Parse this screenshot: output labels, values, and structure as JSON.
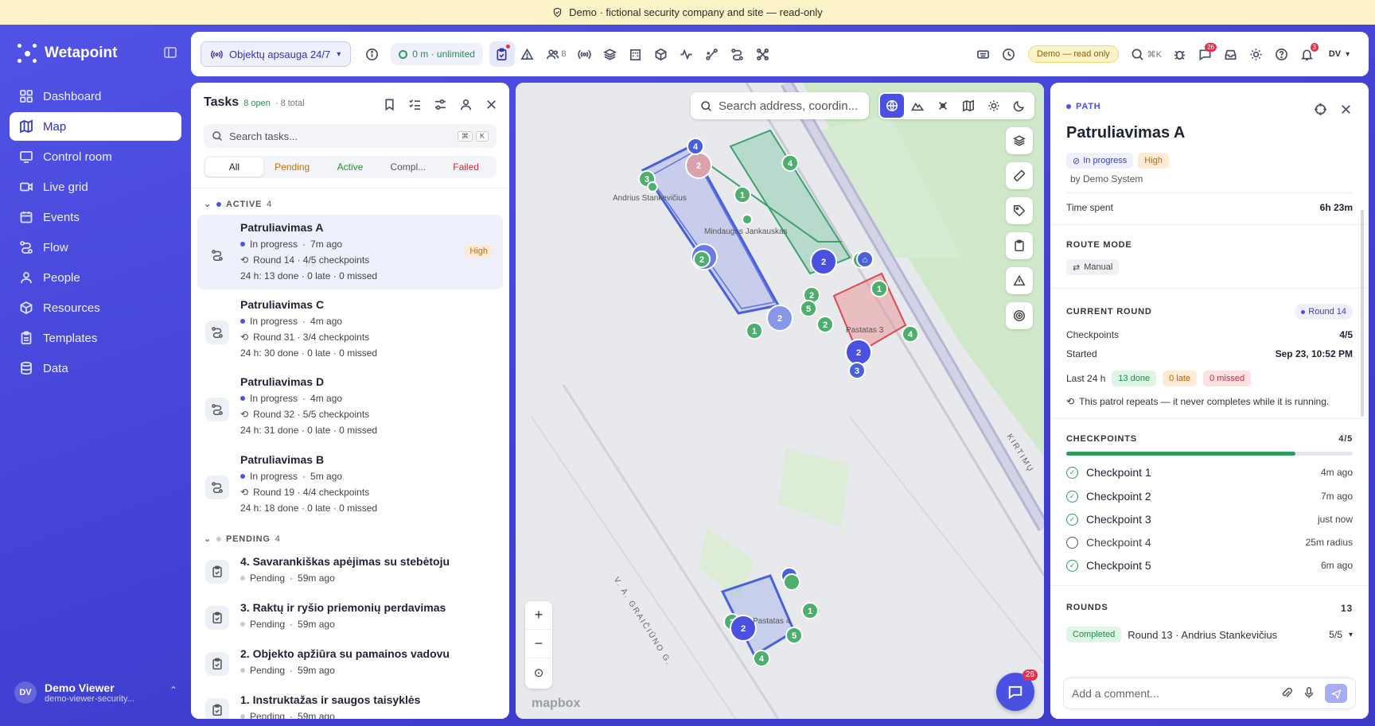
{
  "banner": {
    "text": "Demo · fictional security company and site — read-only"
  },
  "app": {
    "name": "Wetapoint"
  },
  "sidebar": {
    "items": [
      {
        "label": "Dashboard",
        "icon": "grid-icon"
      },
      {
        "label": "Map",
        "icon": "map-icon",
        "active": true
      },
      {
        "label": "Control room",
        "icon": "monitor-icon"
      },
      {
        "label": "Live grid",
        "icon": "video-icon"
      },
      {
        "label": "Events",
        "icon": "calendar-icon"
      },
      {
        "label": "Flow",
        "icon": "flow-icon"
      },
      {
        "label": "People",
        "icon": "people-icon"
      },
      {
        "label": "Resources",
        "icon": "box-icon"
      },
      {
        "label": "Templates",
        "icon": "clipboard-icon"
      },
      {
        "label": "Data",
        "icon": "database-icon"
      }
    ],
    "user": {
      "initials": "DV",
      "name": "Demo Viewer",
      "email": "demo-viewer-security..."
    }
  },
  "topbar": {
    "site": "Objektų apsauga 24/7",
    "distance": "0 m · unlimited",
    "people_count": "8",
    "messages_badge": "26",
    "demo_label": "Demo — read only",
    "search_shortcut": "⌘K",
    "notif_badge": "3",
    "user_initials": "DV"
  },
  "tasks": {
    "title": "Tasks",
    "open": "8 open",
    "total": "· 8 total",
    "search_placeholder": "Search tasks...",
    "filters": [
      "All",
      "Pending",
      "Active",
      "Compl...",
      "Failed"
    ],
    "active_group": {
      "label": "ACTIVE",
      "count": "4"
    },
    "active": [
      {
        "name": "Patruliavimas A",
        "status": "In progress",
        "ago": "7m ago",
        "round": "Round 14 · 4/5 checkpoints",
        "stats": "24 h: 13 done · 0 late · 0 missed",
        "priority": "High"
      },
      {
        "name": "Patruliavimas C",
        "status": "In progress",
        "ago": "4m ago",
        "round": "Round 31 · 3/4 checkpoints",
        "stats": "24 h: 30 done · 0 late · 0 missed"
      },
      {
        "name": "Patruliavimas D",
        "status": "In progress",
        "ago": "4m ago",
        "round": "Round 32 · 5/5 checkpoints",
        "stats": "24 h: 31 done · 0 late · 0 missed"
      },
      {
        "name": "Patruliavimas B",
        "status": "In progress",
        "ago": "5m ago",
        "round": "Round 19 · 4/4 checkpoints",
        "stats": "24 h: 18 done · 0 late · 0 missed"
      }
    ],
    "pending_group": {
      "label": "PENDING",
      "count": "4"
    },
    "pending": [
      {
        "name": "4. Savarankiškas apėjimas su stebėtoju",
        "status": "Pending",
        "ago": "59m ago"
      },
      {
        "name": "3. Raktų ir ryšio priemonių perdavimas",
        "status": "Pending",
        "ago": "59m ago"
      },
      {
        "name": "2. Objekto apžiūra su pamainos vadovu",
        "status": "Pending",
        "ago": "59m ago"
      },
      {
        "name": "1. Instruktažas ir saugos taisyklės",
        "status": "Pending",
        "ago": "59m ago"
      }
    ]
  },
  "map": {
    "search_placeholder": "Search address, coordin...",
    "labels": {
      "andrius": "Andrius Stankevičius",
      "mindaugas": "Mindaugas Jankauskas",
      "pastatas3": "Pastatas 3",
      "pastatas4": "Pastatas 4",
      "street1": "V. A. GRAIČIŪNO G.",
      "street2": "KIRTIMŲ"
    },
    "mapbox": "mapbox",
    "chat_badge": "26"
  },
  "detail": {
    "kind": "PATH",
    "title": "Patruliavimas A",
    "status": "In progress",
    "priority": "High",
    "created_by": "by Demo System",
    "time_spent_label": "Time spent",
    "time_spent": "6h 23m",
    "route_mode_label": "ROUTE MODE",
    "route_mode": "Manual",
    "current_round_label": "CURRENT ROUND",
    "round_badge": "Round 14",
    "checkpoints_label": "Checkpoints",
    "checkpoints_value": "4/5",
    "started_label": "Started",
    "started_value": "Sep 23, 10:52 PM",
    "last24_label": "Last 24 h",
    "last24_done": "13 done",
    "last24_late": "0 late",
    "last24_missed": "0 missed",
    "repeat_note": "This patrol repeats — it never completes while it is running.",
    "checkpoints_section": "CHECKPOINTS",
    "checkpoints_section_value": "4/5",
    "progress_fraction": 0.8,
    "checkpoints": [
      {
        "name": "Checkpoint 1",
        "time": "4m ago",
        "done": true
      },
      {
        "name": "Checkpoint 2",
        "time": "7m ago",
        "done": true
      },
      {
        "name": "Checkpoint 3",
        "time": "just now",
        "done": true
      },
      {
        "name": "Checkpoint 4",
        "time": "25m radius",
        "done": false
      },
      {
        "name": "Checkpoint 5",
        "time": "6m ago",
        "done": true
      }
    ],
    "rounds_label": "ROUNDS",
    "rounds_count": "13",
    "round_row": {
      "status": "Completed",
      "text": "Round 13 · Andrius Stankevičius",
      "value": "5/5"
    },
    "comment_placeholder": "Add a comment..."
  }
}
